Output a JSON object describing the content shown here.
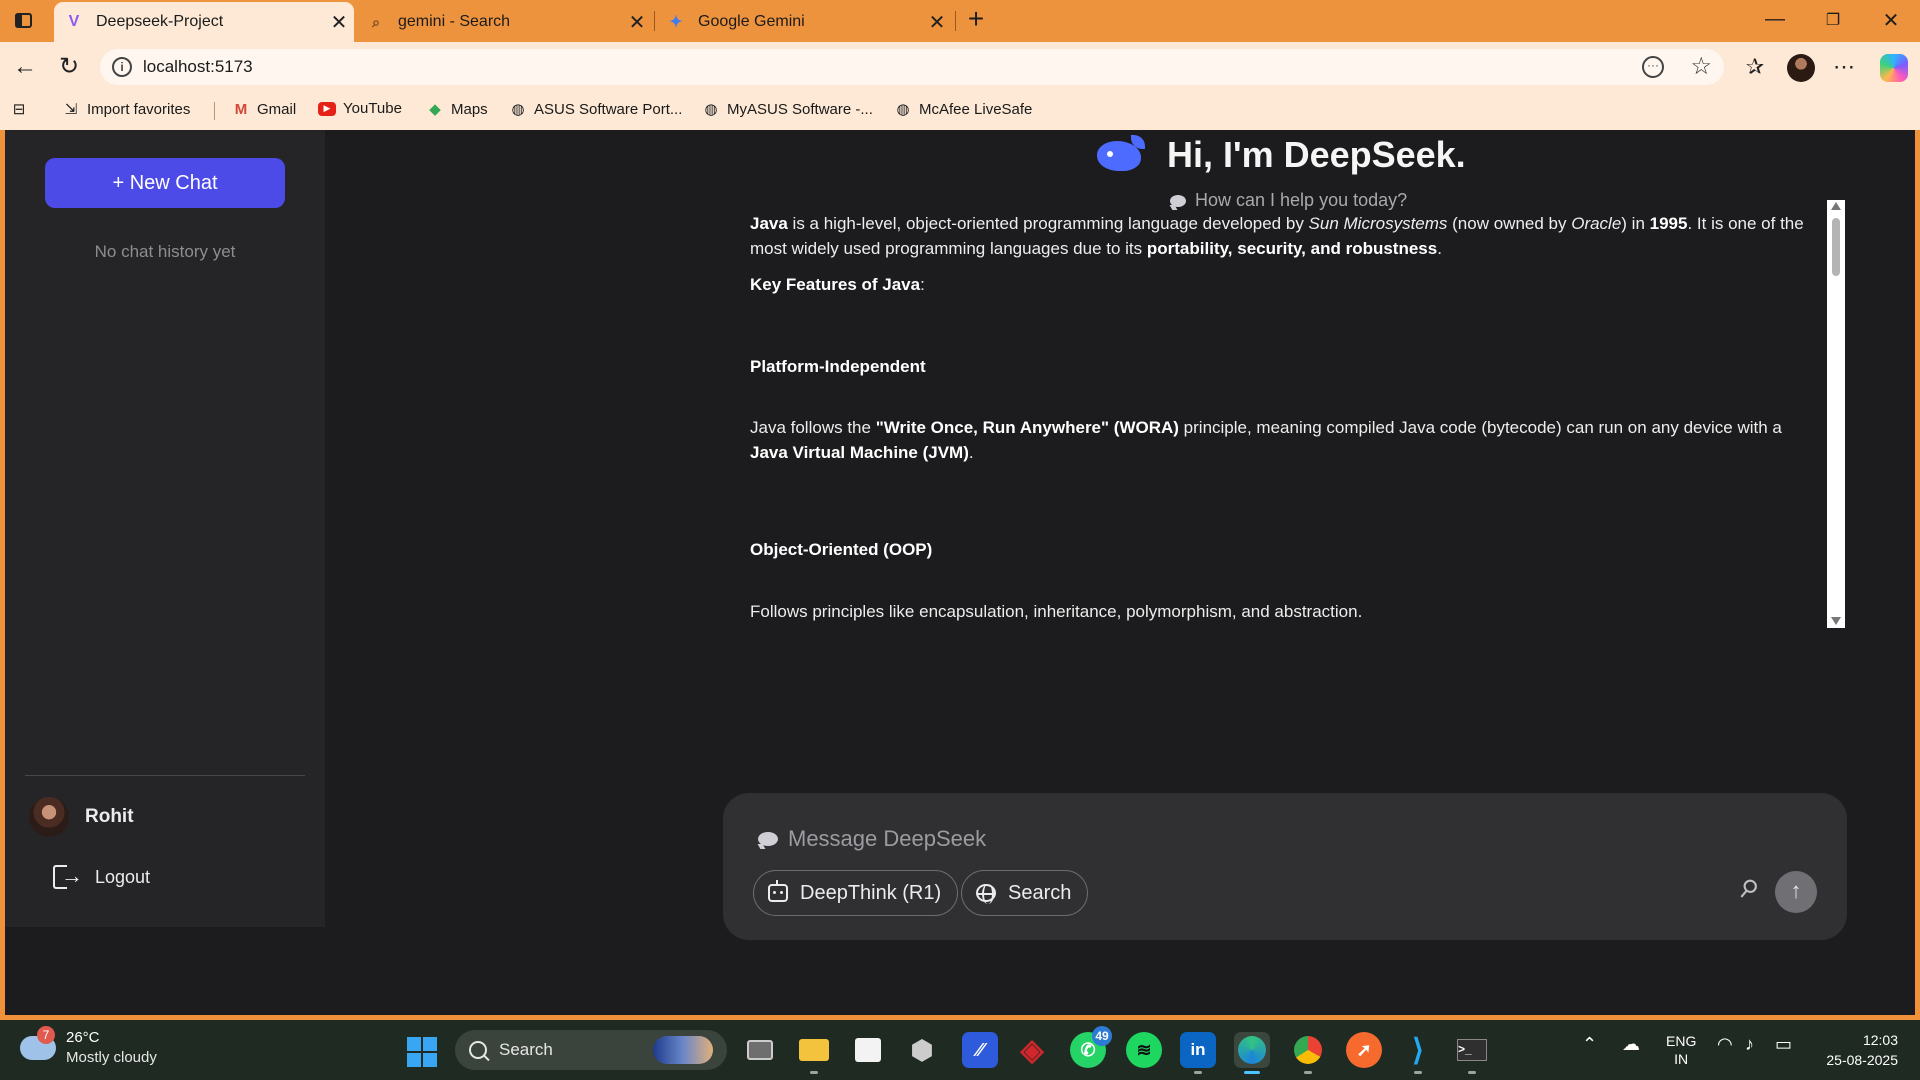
{
  "browser": {
    "tabs": [
      {
        "title": "Deepseek-Project",
        "active": true,
        "favicon": "vite-icon"
      },
      {
        "title": "gemini - Search",
        "active": false,
        "favicon": "search-icon"
      },
      {
        "title": "Google Gemini",
        "active": false,
        "favicon": "gemini-icon"
      }
    ],
    "url": "localhost:5173",
    "favorites": [
      {
        "label": "Import favorites",
        "icon": "import-icon"
      },
      {
        "label": "Gmail",
        "icon": "gmail-icon"
      },
      {
        "label": "YouTube",
        "icon": "youtube-icon"
      },
      {
        "label": "Maps",
        "icon": "maps-icon"
      },
      {
        "label": "ASUS Software Port...",
        "icon": "globe-icon"
      },
      {
        "label": "MyASUS Software -...",
        "icon": "globe-icon"
      },
      {
        "label": "McAfee LiveSafe",
        "icon": "globe-icon"
      }
    ]
  },
  "sidebar": {
    "new_chat_label": "+ New Chat",
    "empty_history": "No chat history yet",
    "user_name": "Rohit",
    "logout_label": "Logout"
  },
  "main": {
    "greeting": "Hi, I'm DeepSeek.",
    "subtitle": "How can I help you today?",
    "answer": {
      "intro": {
        "java": "Java",
        "t1": " is a high-level, object-oriented programming language developed by ",
        "sun": "Sun Microsystems",
        "t2": " (now owned by ",
        "oracle": "Oracle",
        "t3": ") in ",
        "year": "1995",
        "t4": ". It is one of the most widely used programming languages due to its ",
        "strengths": "portability, security, and robustness",
        "t5": "."
      },
      "features_heading": "Key Features of Java",
      "features_colon": ":",
      "feature1_title": "Platform-Independent",
      "feature1_body": {
        "t1": "Java follows the ",
        "wora": "\"Write Once, Run Anywhere\" (WORA)",
        "t2": " principle, meaning compiled Java code (bytecode) can run on any device with a ",
        "jvm": "Java Virtual Machine (JVM)",
        "t3": "."
      },
      "feature2_title": "Object-Oriented (OOP)",
      "feature2_body": "Follows principles like encapsulation, inheritance, polymorphism, and abstraction."
    },
    "composer": {
      "placeholder": "Message DeepSeek",
      "deepthink_label": "DeepThink (R1)",
      "search_label": "Search"
    }
  },
  "taskbar": {
    "weather_badge": "7",
    "temperature": "26°C",
    "weather_desc": "Mostly cloudy",
    "search_label": "Search",
    "whatsapp_count": "49",
    "language": "ENG",
    "region": "IN",
    "time": "12:03",
    "date": "25-08-2025"
  }
}
